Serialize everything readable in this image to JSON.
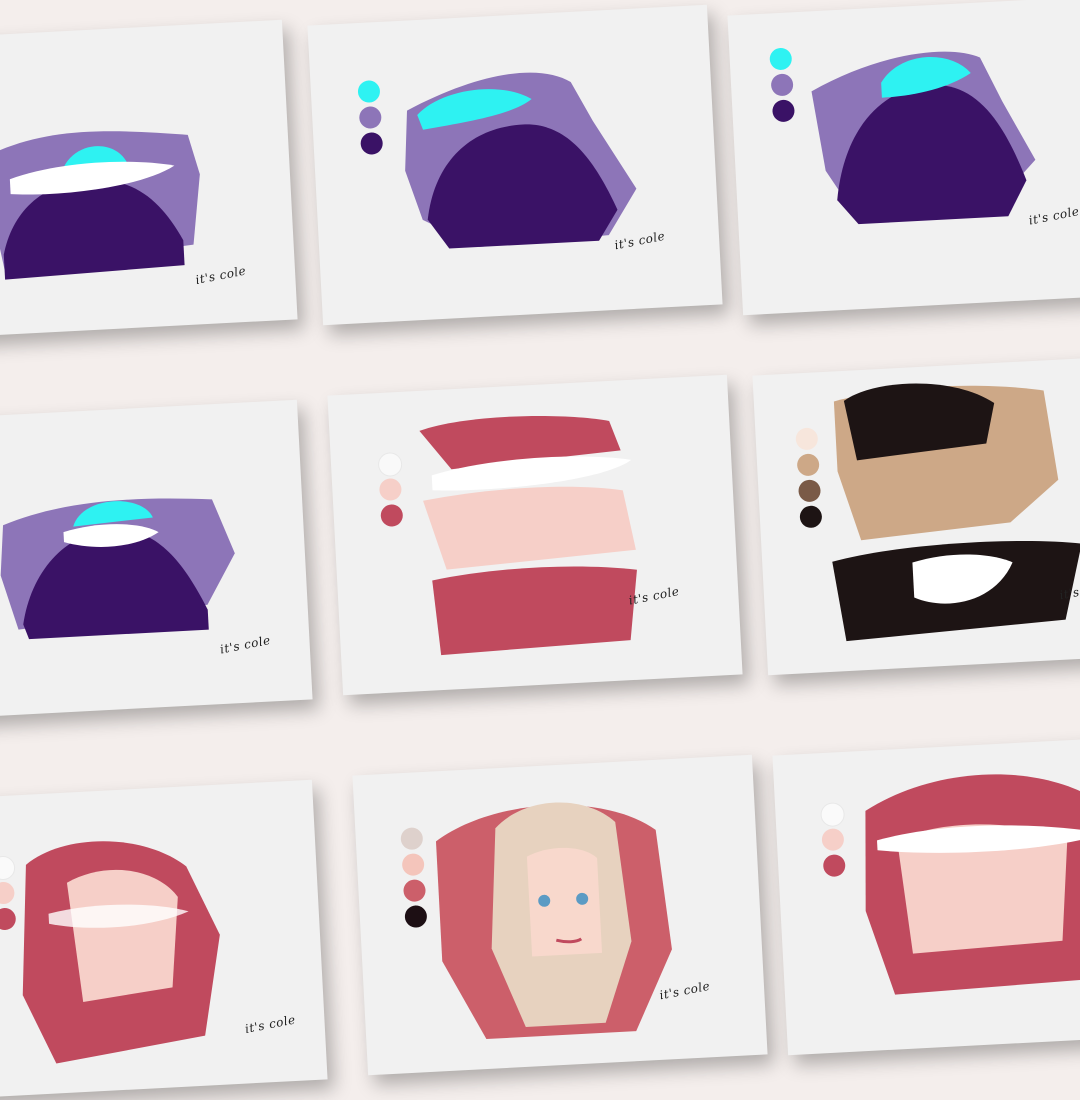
{
  "page": {
    "background": "#f4eeec"
  },
  "signature": "it's cole",
  "cards": [
    {
      "id": "purple-cyan-1",
      "palette": []
    },
    {
      "id": "purple-cyan-2",
      "palette": [
        "#2ef2f2",
        "#8d75b8",
        "#3a1266"
      ]
    },
    {
      "id": "purple-cyan-3",
      "palette": [
        "#2ef2f2",
        "#8d75b8",
        "#3a1266"
      ]
    },
    {
      "id": "purple-cyan-4",
      "palette": []
    },
    {
      "id": "pink-1",
      "palette": [
        "#f9f9f9",
        "#f6cfc8",
        "#c04a5e"
      ]
    },
    {
      "id": "mono-brown",
      "palette": [
        "#f7e6dc",
        "#cda887",
        "#7a5a47",
        "#1d1414"
      ]
    },
    {
      "id": "pink-2",
      "palette": [
        "#fafafa",
        "#f6cfc8",
        "#c04a5e"
      ]
    },
    {
      "id": "girl-cat-ears",
      "palette": [
        "#ded1cc",
        "#f4c5bb",
        "#cc5f6a",
        "#1d0f14"
      ]
    },
    {
      "id": "pink-3",
      "palette": [
        "#fafafa",
        "#f6cfc8",
        "#c04a5e"
      ]
    }
  ]
}
